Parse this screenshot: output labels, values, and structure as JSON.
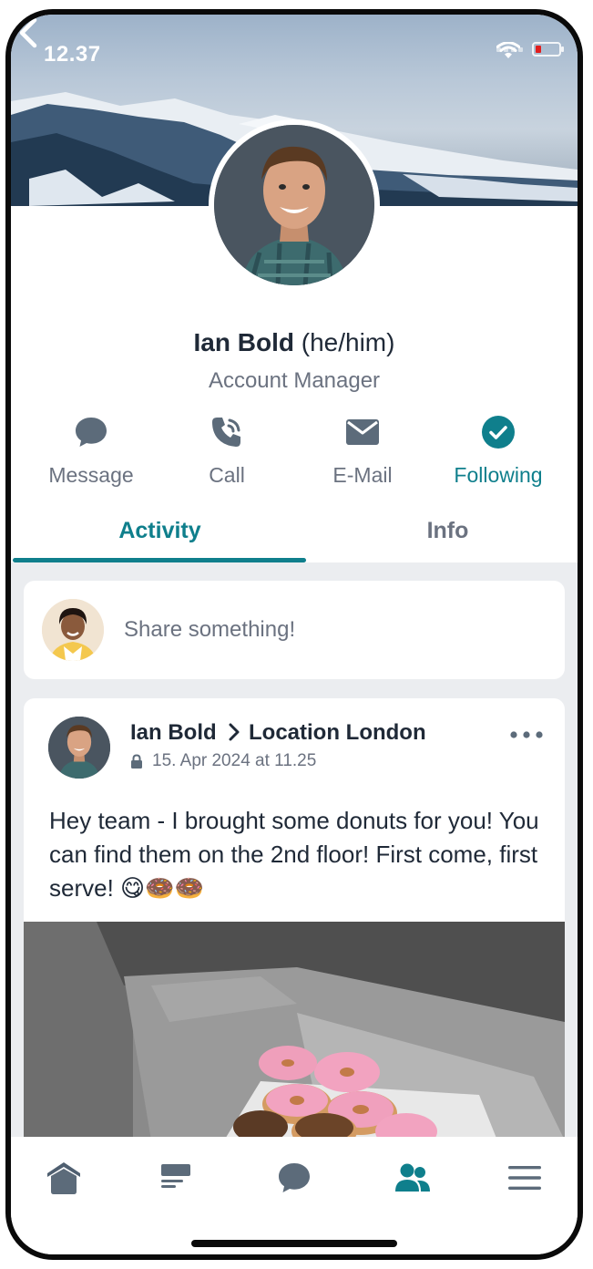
{
  "status_bar": {
    "time": "12.37"
  },
  "profile": {
    "name": "Ian Bold",
    "pronouns": "(he/him)",
    "role": "Account Manager"
  },
  "actions": [
    {
      "label": "Message",
      "icon": "chat-bubble-icon"
    },
    {
      "label": "Call",
      "icon": "phone-icon"
    },
    {
      "label": "E-Mail",
      "icon": "envelope-icon"
    },
    {
      "label": "Following",
      "icon": "check-circle-icon",
      "active": true
    }
  ],
  "tabs": [
    {
      "label": "Activity",
      "active": true
    },
    {
      "label": "Info",
      "active": false
    }
  ],
  "composer": {
    "placeholder": "Share something!"
  },
  "post": {
    "author": "Ian Bold",
    "location": "Location London",
    "timestamp": "15. Apr 2024 at 11.25",
    "body": "Hey team - I brought some donuts for you! You can find them on the 2nd floor! First come, first serve! 😋🍩🍩"
  },
  "bottom_nav": [
    {
      "name": "home",
      "icon": "home-icon"
    },
    {
      "name": "news",
      "icon": "news-icon"
    },
    {
      "name": "chat",
      "icon": "chat-icon"
    },
    {
      "name": "people",
      "icon": "people-icon",
      "active": true
    },
    {
      "name": "menu",
      "icon": "menu-icon"
    }
  ],
  "colors": {
    "accent": "#0f7f8c",
    "icon_gray": "#5c6b7a",
    "text_dark": "#1f2937",
    "text_muted": "#6b7280",
    "feed_background": "#ebedf0"
  }
}
